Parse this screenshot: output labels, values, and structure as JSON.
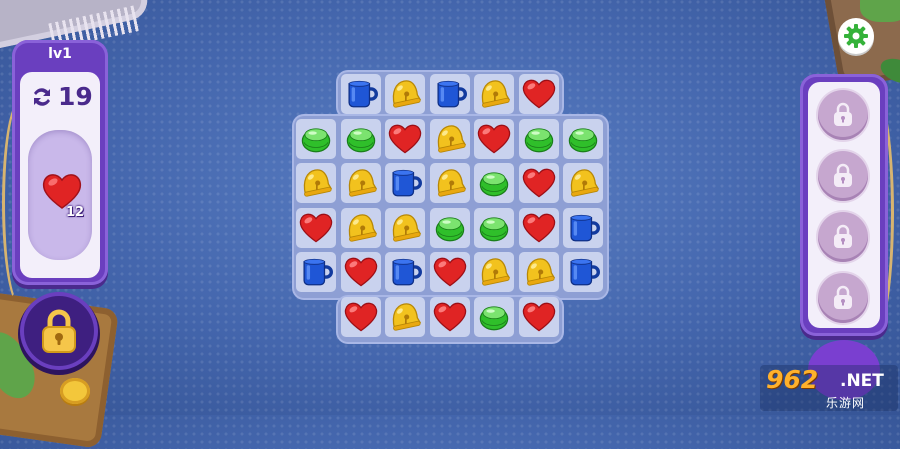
{
  "hud": {
    "level_label": "lv1",
    "moves_left": "19",
    "moves_icon": "moves-icon",
    "goal": {
      "piece": "heart",
      "remaining": "12"
    },
    "settings_icon": "gear-icon"
  },
  "left_booster": {
    "icon": "padlock-icon",
    "state": "locked"
  },
  "right_boosters": [
    {
      "icon": "padlock-icon",
      "state": "locked"
    },
    {
      "icon": "padlock-icon",
      "state": "locked"
    },
    {
      "icon": "padlock-icon",
      "state": "locked"
    },
    {
      "icon": "padlock-icon",
      "state": "locked"
    }
  ],
  "colors": {
    "background": "#4a6db3",
    "panel_purple": "#6a3fbf",
    "board": "#8e9fd4",
    "heart": "#e02424",
    "mug": "#1f56d6",
    "bell": "#f2c21e",
    "gem": "#2fbf2a"
  },
  "board": {
    "rows": [
      [
        null,
        "mug",
        "bell",
        "mug",
        "bell",
        "heart",
        null
      ],
      [
        "gem",
        "gem",
        "heart",
        "bell",
        "heart",
        "gem",
        "gem"
      ],
      [
        "bell",
        "bell",
        "mug",
        "bell",
        "gem",
        "heart",
        "bell"
      ],
      [
        "heart",
        "bell",
        "bell",
        "gem",
        "gem",
        "heart",
        "mug"
      ],
      [
        "mug",
        "heart",
        "mug",
        "heart",
        "bell",
        "bell",
        "mug"
      ],
      [
        null,
        "heart",
        "bell",
        "heart",
        "gem",
        "heart",
        null
      ]
    ]
  },
  "watermark": {
    "main": "962",
    "suffix": ".NET",
    "sub": "乐游网"
  }
}
